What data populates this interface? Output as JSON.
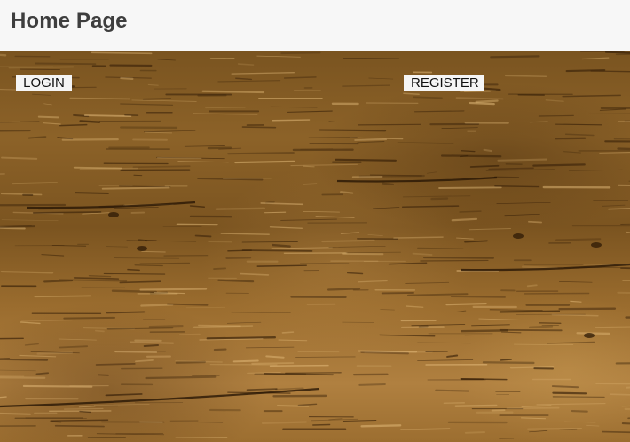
{
  "header": {
    "title": "Home Page"
  },
  "actions": {
    "login_label": "LOGIN",
    "register_label": "REGISTER"
  },
  "background": {
    "description_icon": "wood-texture",
    "colors": {
      "wood_dark": "#5a3a12",
      "wood_mid": "#8c6228",
      "wood_light": "#c79a52"
    }
  }
}
